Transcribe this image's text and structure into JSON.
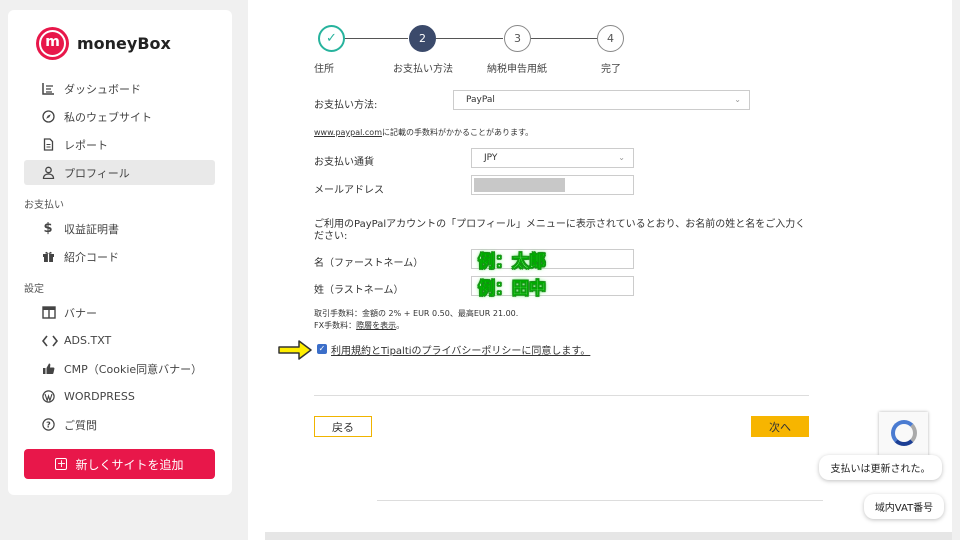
{
  "brand": {
    "name": "moneyBox",
    "mark": "m"
  },
  "nav": {
    "dashboard": "ダッシュボード",
    "my_websites": "私のウェブサイト",
    "report": "レポート",
    "profile": "プロフィール",
    "payments_section": "お支払い",
    "earnings": "収益証明書",
    "referral": "紹介コード",
    "settings_section": "設定",
    "banner": "バナー",
    "ads_txt": "ADS.TXT",
    "cmp": "CMP（Cookie同意バナー）",
    "wordpress": "WORDPRESS",
    "faq": "ご質問",
    "add_site": "新しくサイトを追加"
  },
  "steps": [
    {
      "number": "✓",
      "label": "住所",
      "state": "done"
    },
    {
      "number": "2",
      "label": "お支払い方法",
      "state": "current"
    },
    {
      "number": "3",
      "label": "納税申告用紙",
      "state": "todo"
    },
    {
      "number": "4",
      "label": "完了",
      "state": "todo"
    }
  ],
  "form": {
    "payment_method_label": "お支払い方法:",
    "payment_method_value": "PayPal",
    "fee_note_link": "www.paypal.com",
    "fee_note_rest": "に記載の手数料がかかることがあります。",
    "currency_label": "お支払い通貨",
    "currency_value": "JPY",
    "email_label": "メールアドレス",
    "paypal_instruction": "ご利用のPayPalアカウントの「プロフィール」メニューに表示されているとおり、お名前の姓と名をご入力ください:",
    "first_name_label": "名（ファーストネーム）",
    "last_name_label": "姓（ラストネーム）",
    "first_name_example": "例：太郎",
    "last_name_example": "例：田中",
    "fee_line1": "取引手数料：金額の 2% + EUR 0.50、最高EUR 21.00.",
    "fee_line2_prefix": "FX手数料：",
    "fee_line2_link": "際層を表示",
    "fee_line2_suffix": "。",
    "agree_text": "利用規約とTipaltiのプライバシーポリシーに同意します。",
    "back_button": "戻る",
    "next_button": "次へ"
  },
  "toasts": {
    "payment_updated": "支払いは更新された。",
    "vat": "域内VAT番号"
  },
  "colors": {
    "brand": "#e8174a",
    "step_done": "#27b39d",
    "step_current": "#3b4a6b",
    "next_button": "#f7b500"
  }
}
